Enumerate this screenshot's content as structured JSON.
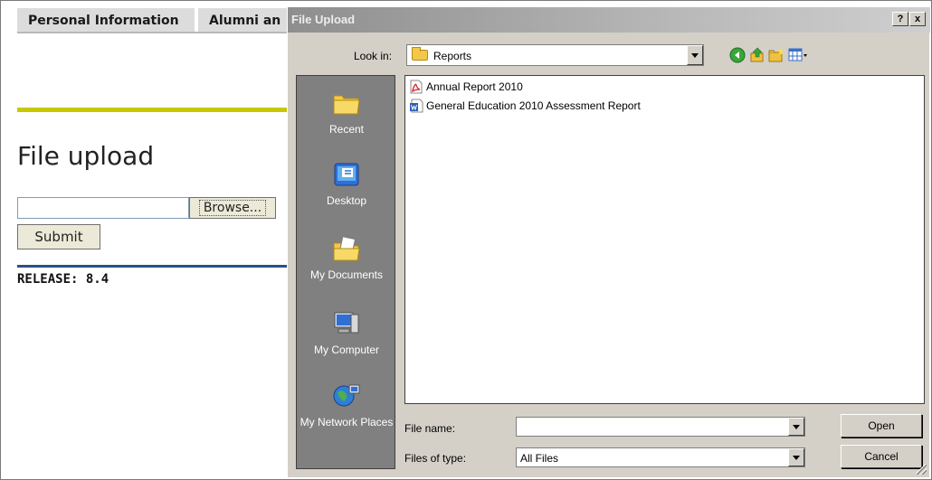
{
  "page": {
    "tabs": [
      "Personal Information",
      "Alumni an"
    ],
    "title": "File upload",
    "browse_label": "Browse...",
    "submit_label": "Submit",
    "release": "RELEASE: 8.4"
  },
  "dialog": {
    "title": "File Upload",
    "help_label": "?",
    "close_label": "x",
    "look_in_label": "Look in:",
    "look_in_value": "Reports",
    "toolbar_icons": [
      "back-icon",
      "up-folder-icon",
      "new-folder-icon",
      "view-menu-icon"
    ],
    "places": [
      {
        "label": "Recent",
        "icon": "recent-folder-icon"
      },
      {
        "label": "Desktop",
        "icon": "desktop-icon"
      },
      {
        "label": "My Documents",
        "icon": "my-documents-icon"
      },
      {
        "label": "My Computer",
        "icon": "my-computer-icon"
      },
      {
        "label": "My Network Places",
        "icon": "network-places-icon"
      }
    ],
    "files": [
      {
        "name": "Annual Report 2010",
        "icon": "pdf-file-icon"
      },
      {
        "name": "General Education 2010 Assessment Report",
        "icon": "word-file-icon"
      }
    ],
    "file_name_label": "File name:",
    "file_name_value": "",
    "files_of_type_label": "Files of type:",
    "files_of_type_value": "All Files",
    "open_label": "Open",
    "cancel_label": "Cancel"
  }
}
